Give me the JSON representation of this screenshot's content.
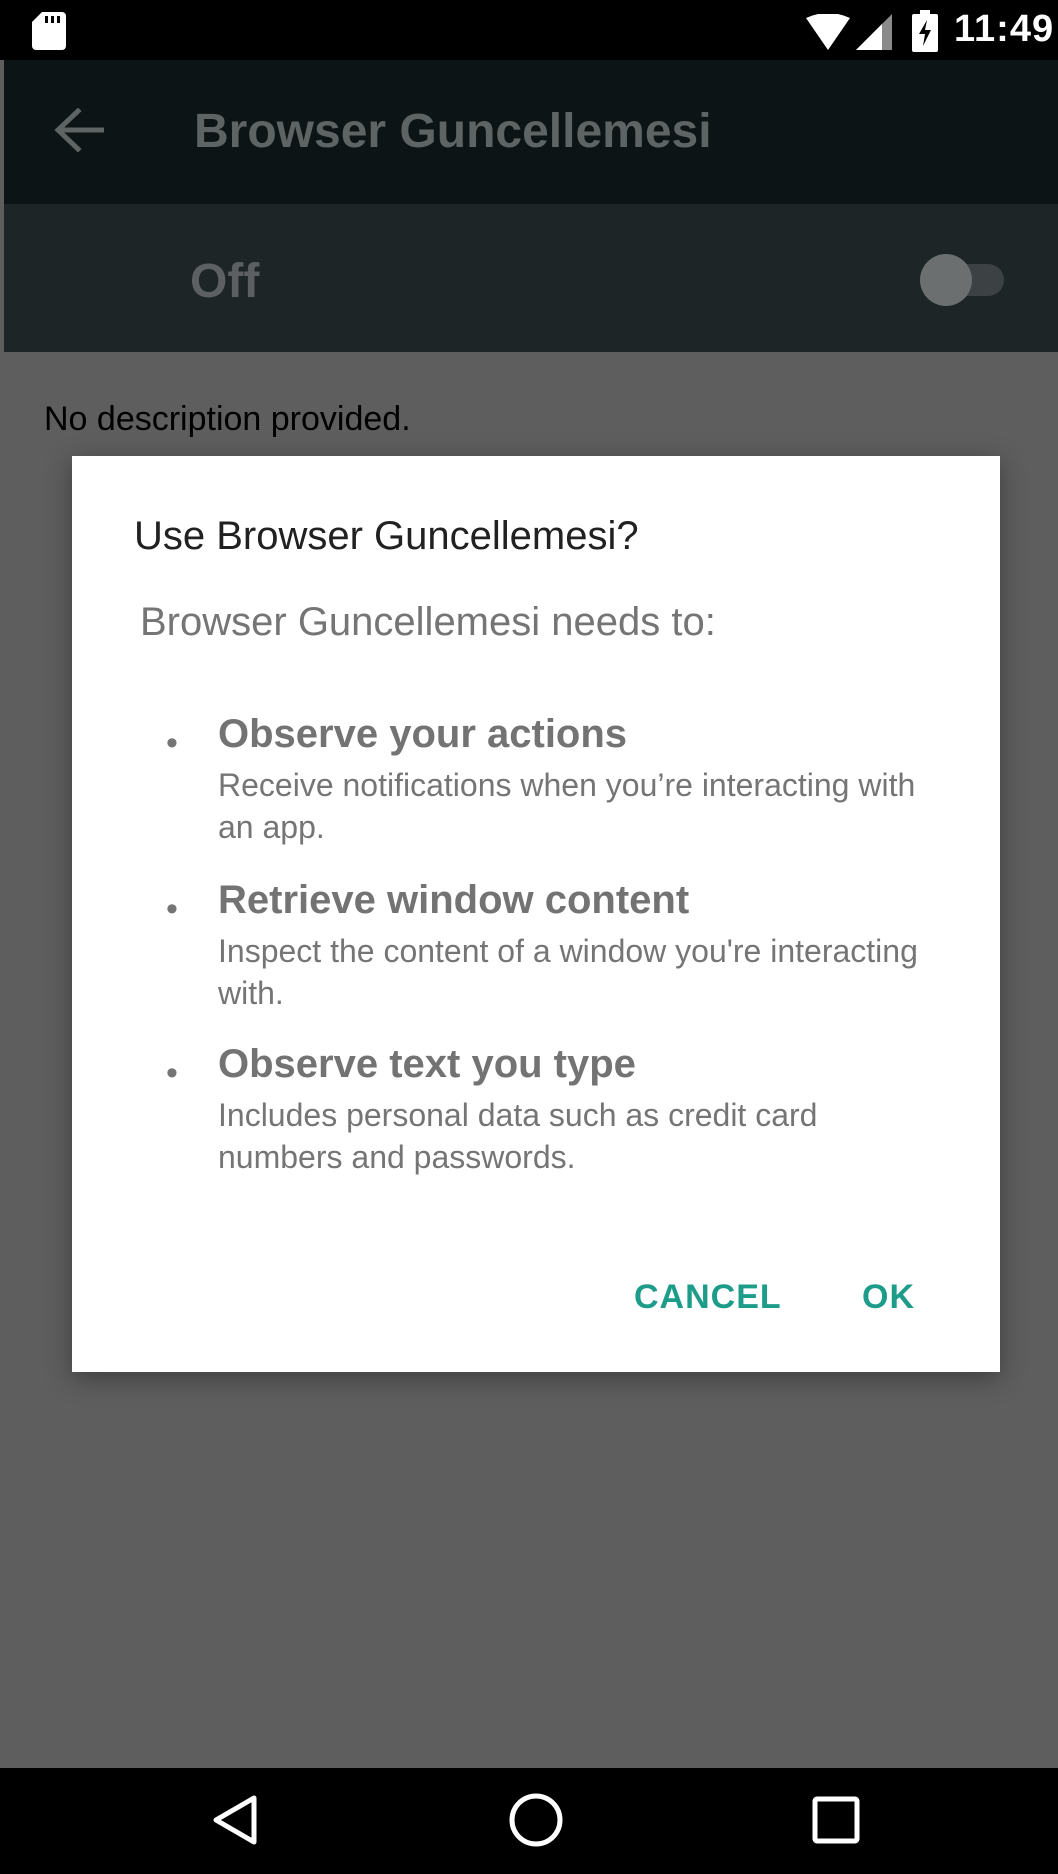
{
  "status_bar": {
    "time": "11:49",
    "icons": [
      "sd-card-icon",
      "wifi-icon",
      "signal-icon",
      "battery-icon"
    ]
  },
  "app_bar": {
    "title": "Browser Guncellemesi",
    "back_icon": "arrow-left-icon"
  },
  "switch_bar": {
    "label": "Off",
    "toggle_on": false
  },
  "description": "No description provided.",
  "dialog": {
    "title": "Use Browser Guncellemesi?",
    "subtitle": "Browser Guncellemesi needs to:",
    "permissions": [
      {
        "title": "Observe your actions",
        "description": "Receive notifications when you’re interacting with an app."
      },
      {
        "title": "Retrieve window content",
        "description": "Inspect the content of a window you're interacting with."
      },
      {
        "title": "Observe text you type",
        "description": "Includes personal data such as credit card numbers and passwords."
      }
    ],
    "bullet": "•",
    "cancel_label": "CANCEL",
    "ok_label": "OK"
  },
  "colors": {
    "accent": "#1e9c8a",
    "app_bar": "#0d1415",
    "switch_bar": "#1d2526",
    "scrim": "#5e5e5e"
  },
  "nav_bar": {
    "icons": [
      "nav-back-icon",
      "nav-home-icon",
      "nav-recents-icon"
    ]
  }
}
